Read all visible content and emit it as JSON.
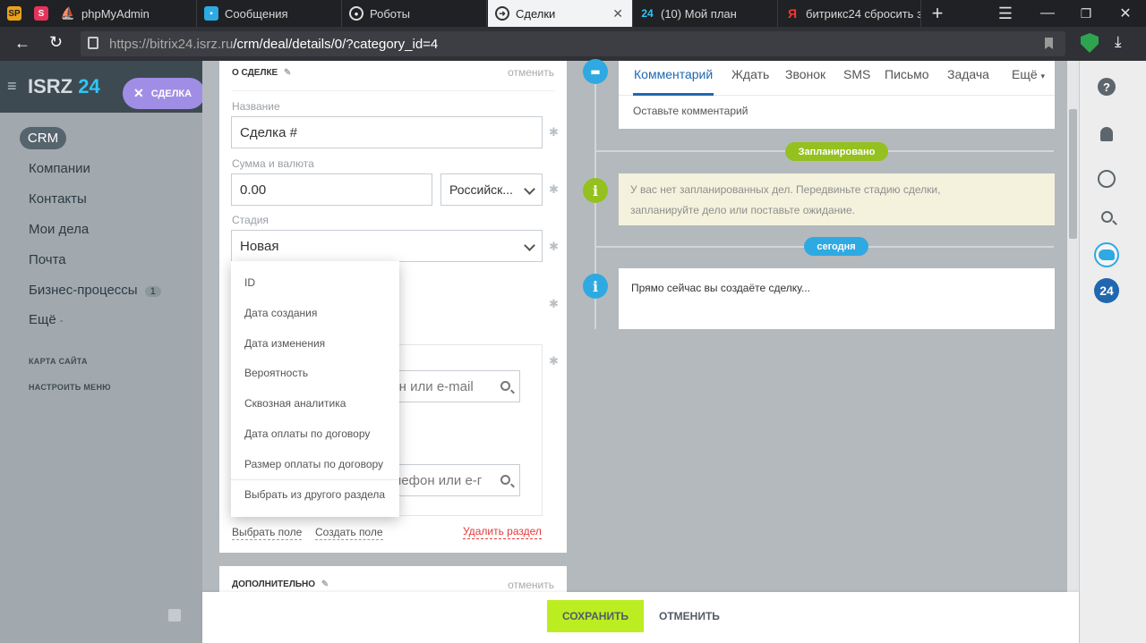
{
  "browser": {
    "tabs": [
      {
        "label": "",
        "icon": "SP"
      },
      {
        "label": "",
        "icon": "S"
      },
      {
        "label": "phpMyAdmin",
        "icon": "pma"
      },
      {
        "label": "Сообщения",
        "icon": "chat"
      },
      {
        "label": "Роботы",
        "icon": "robot"
      },
      {
        "label": "Сделки",
        "icon": "arrow"
      },
      {
        "label": "(10) Мой план",
        "icon": "24"
      },
      {
        "label": "битрикс24 сбросить з",
        "icon": "Я"
      }
    ],
    "url_host": "https://bitrix24.isrz.ru",
    "url_path": "/crm/deal/details/0/?category_id=4"
  },
  "sidebar": {
    "logo": "ISRZ",
    "logo_num": "24",
    "deal_button": "СДЕЛКА",
    "crm": "CRM",
    "items": [
      "Компании",
      "Контакты",
      "Мои дела",
      "Почта",
      "Бизнес-процессы",
      "Ещё"
    ],
    "badge": "1",
    "sitemap": "КАРТА САЙТА",
    "config_menu": "НАСТРОИТЬ МЕНЮ"
  },
  "deal": {
    "section_title": "О СДЕЛКЕ",
    "cancel": "отменить",
    "name_label": "Название",
    "name_value": "Сделка #",
    "sum_label": "Сумма и валюта",
    "sum_value": "0.00",
    "currency": "Российск...",
    "stage_label": "Стадия",
    "stage_value": "Новая",
    "contact_placeholder_1": "фон или e-mail",
    "contact_placeholder_2": "телефон или е-г",
    "choose_field": "Выбрать поле",
    "create_field": "Создать поле",
    "delete_section": "Удалить раздел",
    "extra_title": "ДОПОЛНИТЕЛЬНО",
    "extra_cancel": "отменить"
  },
  "dropdown": [
    "ID",
    "Дата создания",
    "Дата изменения",
    "Вероятность",
    "Сквозная аналитика",
    "Дата оплаты по договору",
    "Размер оплаты по договору",
    "Выбрать из другого раздела"
  ],
  "timeline": {
    "tabs": [
      "Комментарий",
      "Ждать",
      "Звонок",
      "SMS",
      "Письмо",
      "Задача",
      "Ещё"
    ],
    "comment_placeholder": "Оставьте комментарий",
    "planned": "Запланировано",
    "no_planned_1": "У вас нет запланированных дел. Передвиньте стадию сделки,",
    "no_planned_2": "запланируйте дело или поставьте ожидание.",
    "today": "сегодня",
    "creating": "Прямо сейчас вы создаёте сделку..."
  },
  "bottom": {
    "save": "СОХРАНИТЬ",
    "cancel": "ОТМЕНИТЬ"
  },
  "rpanel": {
    "badge": "24"
  },
  "colors": {
    "accent": "#2067b0",
    "green": "#bbed21",
    "purple": "#a08ee6",
    "info": "#2fc6f6"
  }
}
